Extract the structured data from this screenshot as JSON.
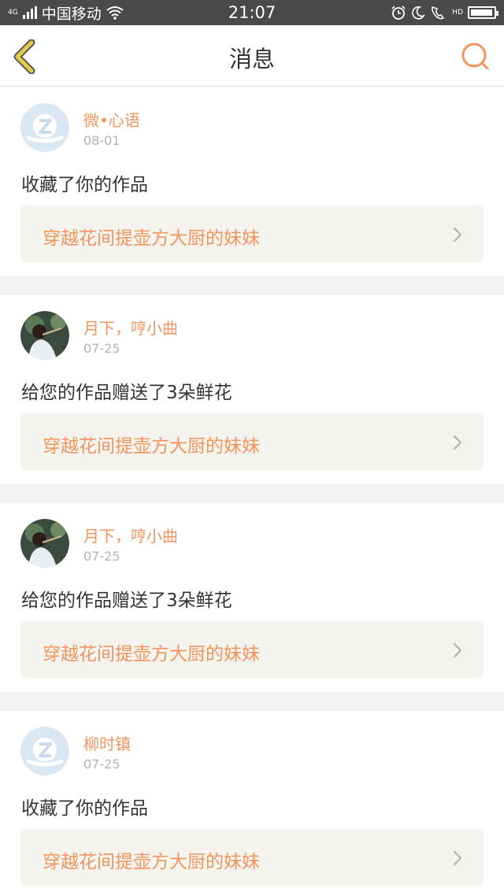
{
  "status_bar": {
    "network": "4G",
    "carrier": "中国移动",
    "time": "21:07",
    "hd": "HD",
    "battery_level": 0.95
  },
  "header": {
    "title": "消息",
    "back_icon": "back-chevron-icon",
    "search_icon": "search-icon"
  },
  "colors": {
    "accent": "#f0955d",
    "back_icon": "#e8c84a",
    "card_bg": "#ffffff",
    "work_bg": "#f4f3ee"
  },
  "messages": [
    {
      "username": "微•心语",
      "date": "08-01",
      "action": "收藏了你的作品",
      "work_title": "穿越花间提壶方大厨的妹妹",
      "avatar": "default-avatar-icon"
    },
    {
      "username": "月下，哼小曲",
      "date": "07-25",
      "action": "给您的作品赠送了3朵鲜花",
      "work_title": "穿越花间提壶方大厨的妹妹",
      "avatar": "photo-avatar"
    },
    {
      "username": "月下，哼小曲",
      "date": "07-25",
      "action": "给您的作品赠送了3朵鲜花",
      "work_title": "穿越花间提壶方大厨的妹妹",
      "avatar": "photo-avatar"
    },
    {
      "username": "柳时镇",
      "date": "07-25",
      "action": "收藏了你的作品",
      "work_title": "穿越花间提壶方大厨的妹妹",
      "avatar": "default-avatar-icon"
    }
  ]
}
